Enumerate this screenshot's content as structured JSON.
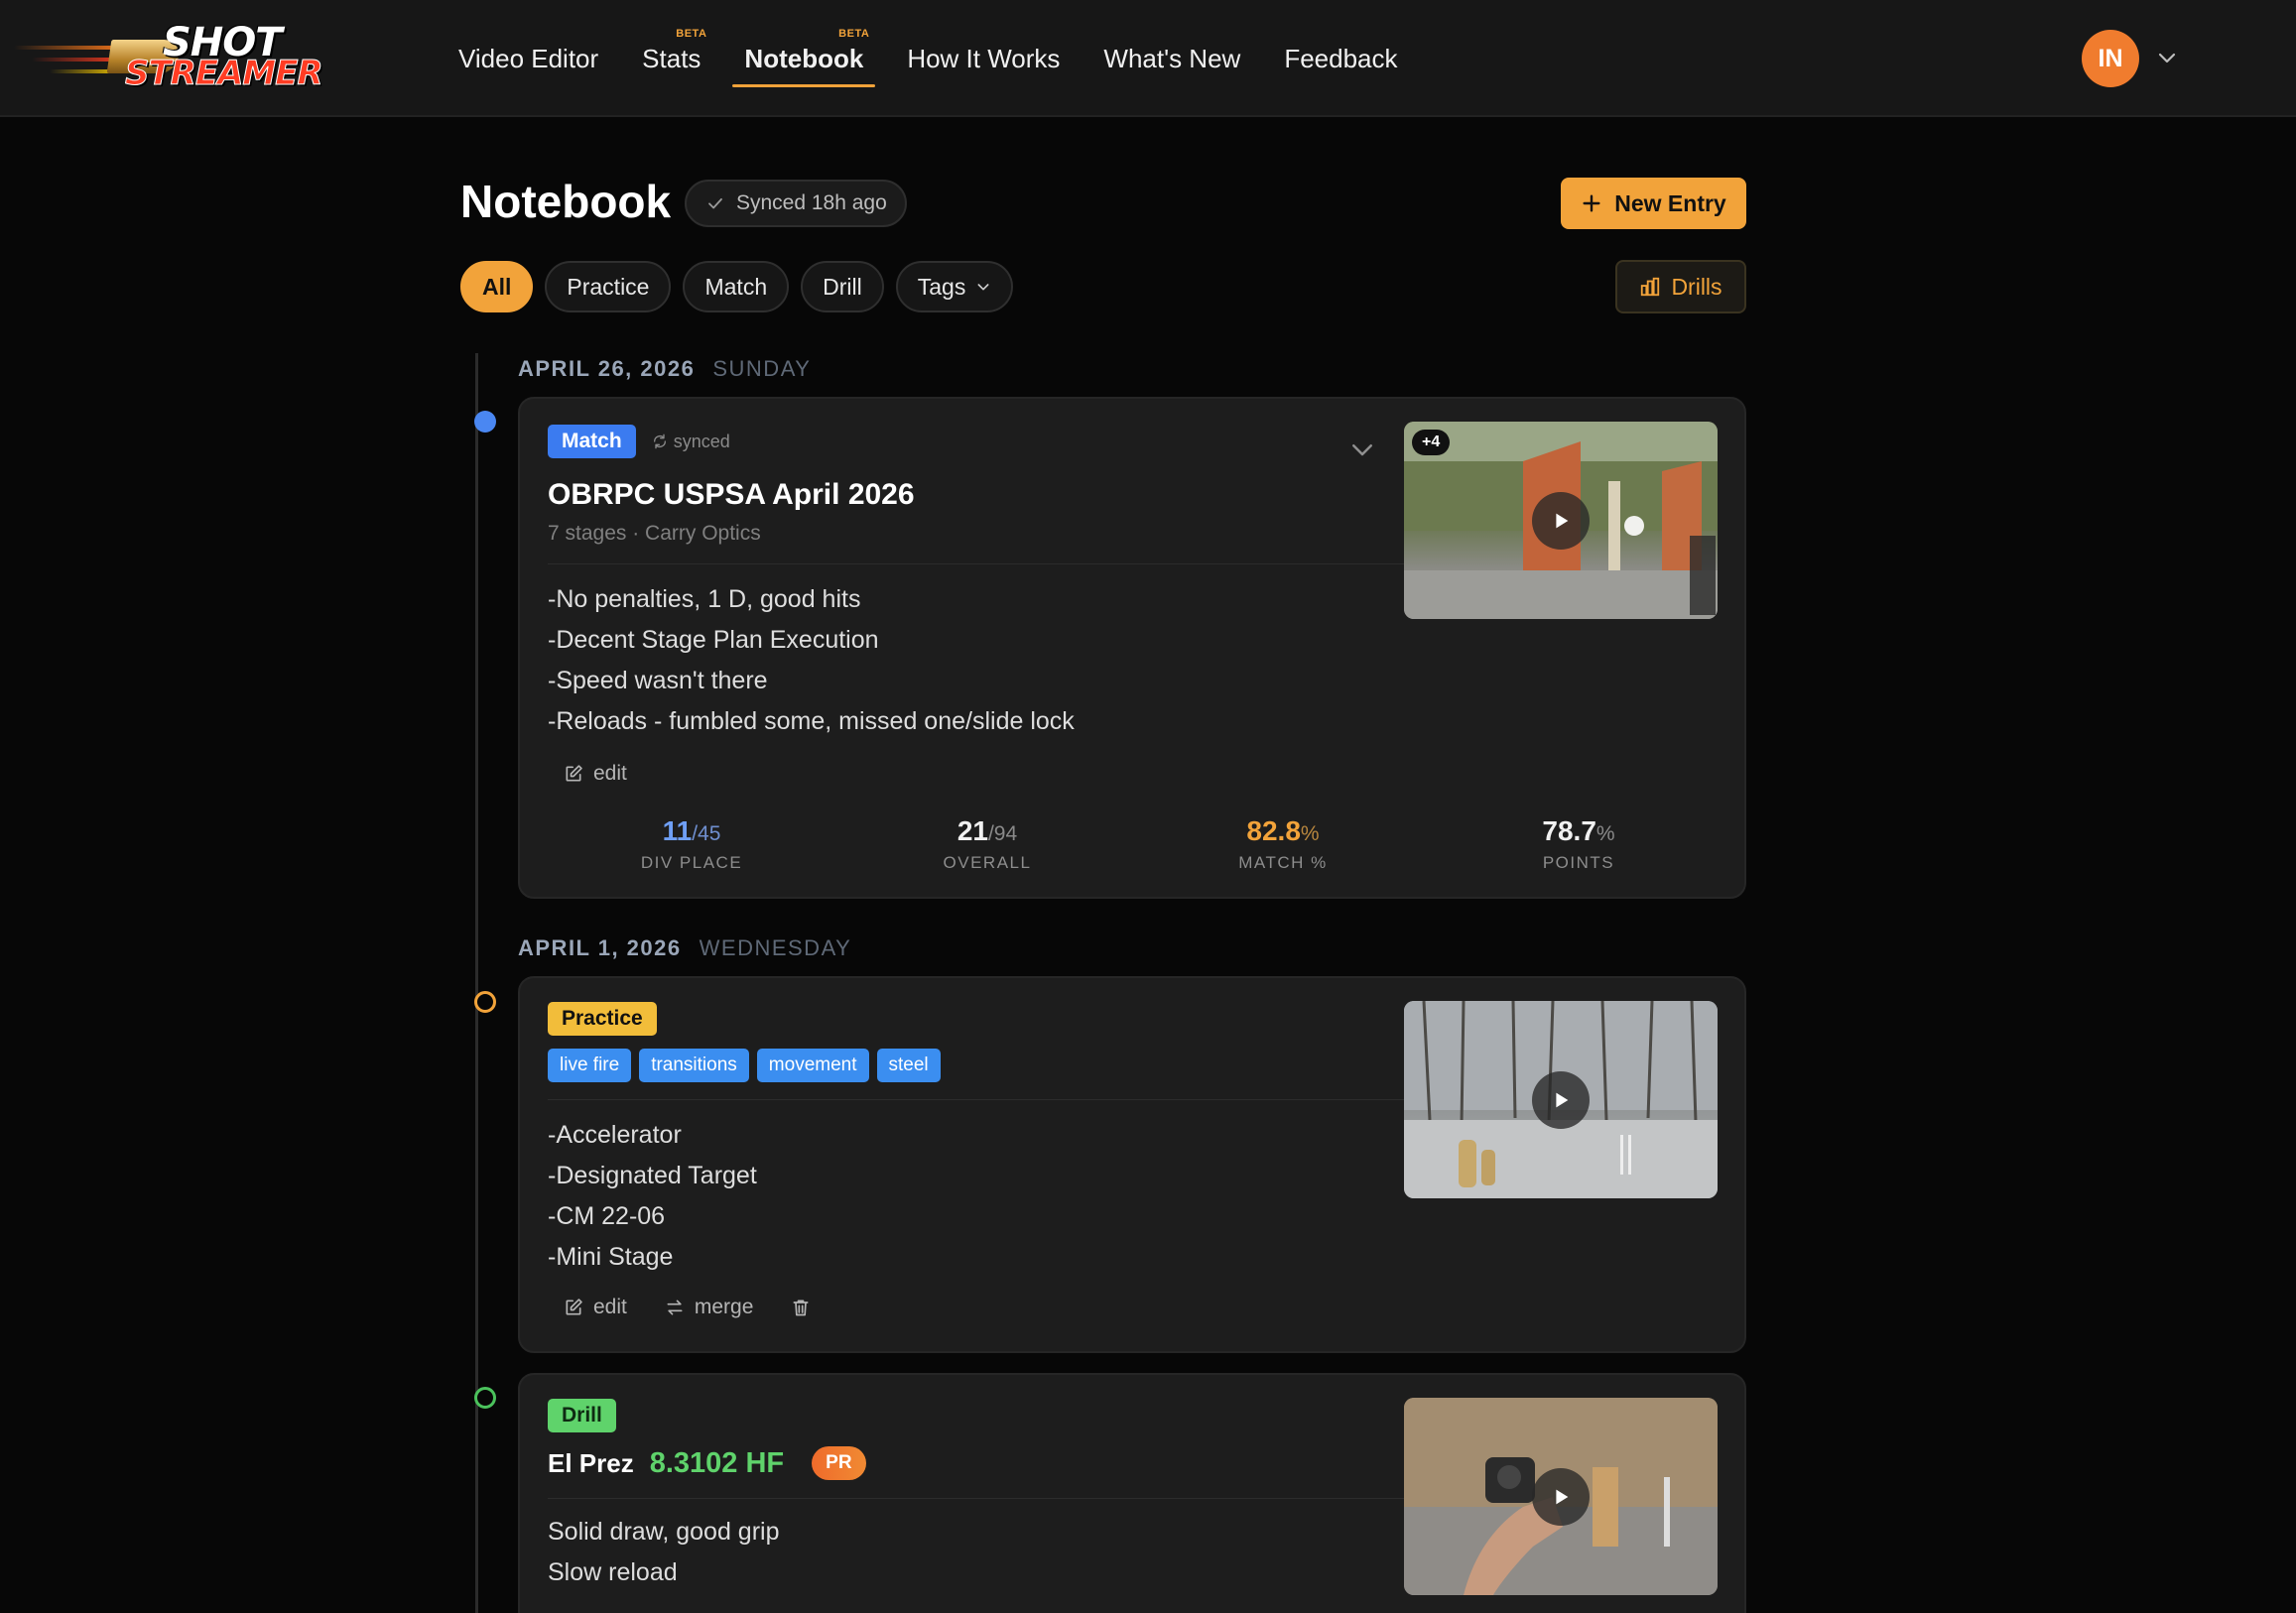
{
  "brand": {
    "line1": "SHOT",
    "line2": "STREAMER"
  },
  "nav": {
    "items": [
      {
        "label": "Video Editor",
        "beta": ""
      },
      {
        "label": "Stats",
        "beta": "BETA"
      },
      {
        "label": "Notebook",
        "beta": "BETA"
      },
      {
        "label": "How It Works",
        "beta": ""
      },
      {
        "label": "What's New",
        "beta": ""
      },
      {
        "label": "Feedback",
        "beta": ""
      }
    ],
    "active": "Notebook",
    "user_initials": "IN"
  },
  "header": {
    "title": "Notebook",
    "sync_status": "Synced 18h ago",
    "new_entry_label": "New Entry",
    "drills_label": "Drills"
  },
  "filters": {
    "all": "All",
    "practice": "Practice",
    "match": "Match",
    "drill": "Drill",
    "tags": "Tags",
    "active": "All"
  },
  "colors": {
    "accent": "#f2a33a",
    "match": "#3b7bf0",
    "practice": "#f2bd3a",
    "drill": "#5fd36b",
    "tag": "#3b8ef0",
    "div_place": "#6f9ff5",
    "match_pct": "#f2a33a"
  },
  "entries": {
    "match": {
      "date": "APRIL 26, 2026",
      "weekday": "SUNDAY",
      "type": "Match",
      "sync_label": "synced",
      "title": "OBRPC USPSA April 2026",
      "subtitle": "7 stages · Carry Optics",
      "notes": [
        "-No penalties, 1 D, good hits",
        "-Decent Stage Plan Execution",
        "-Speed wasn't there",
        "-Reloads - fumbled some, missed one/slide lock"
      ],
      "edit_label": "edit",
      "media_extra": "+4",
      "stats": [
        {
          "value": "11",
          "suffix": "/45",
          "label": "DIV PLACE"
        },
        {
          "value": "21",
          "suffix": "/94",
          "label": "OVERALL"
        },
        {
          "value": "82.8",
          "suffix": "%",
          "label": "MATCH %"
        },
        {
          "value": "78.7",
          "suffix": "%",
          "label": "POINTS"
        }
      ]
    },
    "practice": {
      "date": "APRIL 1, 2026",
      "weekday": "WEDNESDAY",
      "type": "Practice",
      "tags": [
        "live fire",
        "transitions",
        "movement",
        "steel"
      ],
      "notes": [
        "-Accelerator",
        "-Designated Target",
        "-CM 22-06",
        "-Mini Stage"
      ],
      "edit_label": "edit",
      "merge_label": "merge"
    },
    "drill": {
      "type": "Drill",
      "name": "El Prez",
      "score": "8.3102 HF",
      "badge": "PR",
      "notes": [
        "Solid draw, good grip",
        "Slow reload"
      ]
    }
  }
}
